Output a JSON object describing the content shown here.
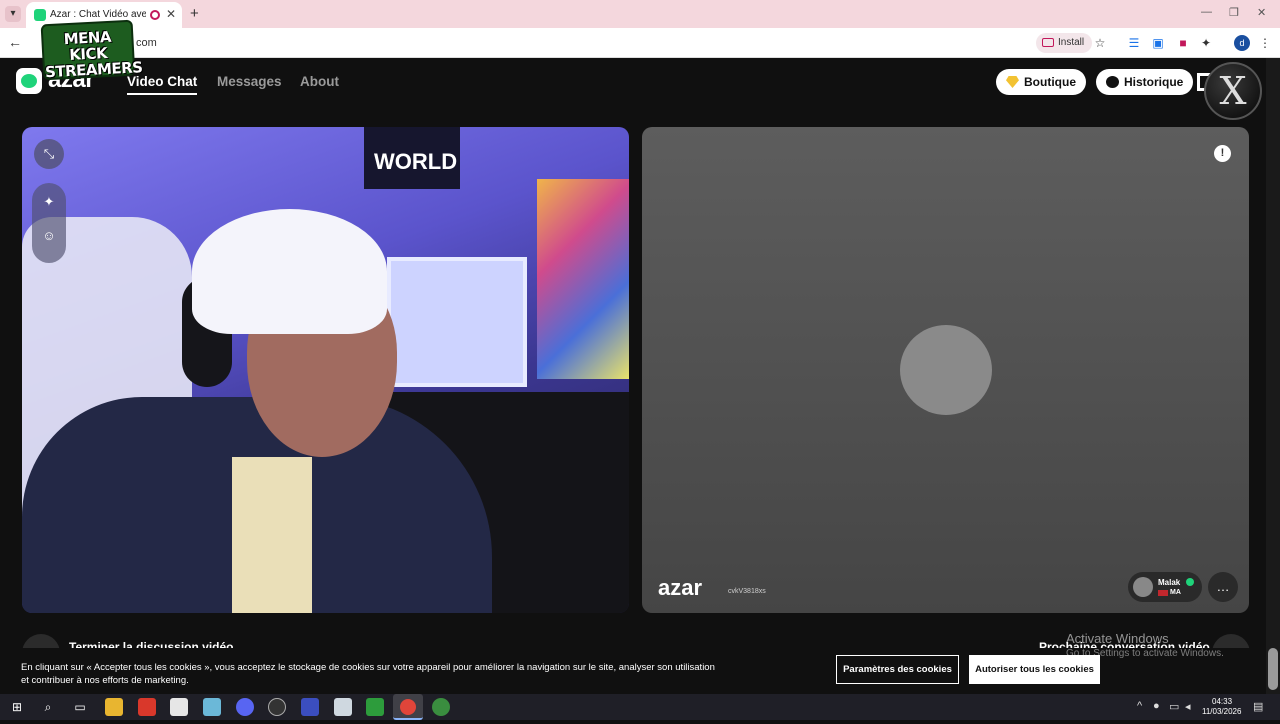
{
  "browser": {
    "tab_title": "Azar : Chat Vidéo avec de n",
    "url": "com",
    "install_label": "Install",
    "profile_initial": "d"
  },
  "overlay": {
    "logo_line1": "MENA KICK",
    "logo_line2": "STREAMERS",
    "x_logo": "X"
  },
  "site": {
    "brand": "azar",
    "nav": [
      "Video Chat",
      "Messages",
      "About"
    ],
    "boutique_label": "Boutique",
    "historique_label": "Historique"
  },
  "local_video": {
    "poster_text": "WORLD"
  },
  "remote_video": {
    "watermark": "azar",
    "session_id": "cvkV3818xs",
    "user_name": "Malak",
    "user_country": "MA"
  },
  "controls": {
    "end_label": "Terminer la discussion vidéo",
    "next_label": "Prochaine conversation vidéo"
  },
  "cookie": {
    "text": "En cliquant sur « Accepter tous les cookies », vous acceptez le stockage de cookies sur votre appareil pour améliorer la navigation sur le site, analyser son utilisation et contribuer à nos efforts de marketing.",
    "settings_label": "Paramètres des cookies",
    "accept_label": "Autoriser tous les cookies"
  },
  "watermark": {
    "line1": "Activate Windows",
    "line2": "Go to Settings to activate Windows."
  },
  "taskbar": {
    "time": "04:33",
    "date": "11/03/2026"
  },
  "colors": {
    "brand_green": "#1fd37a",
    "tab_strip": "#f4d7dd",
    "recording_red": "#c2185b"
  }
}
